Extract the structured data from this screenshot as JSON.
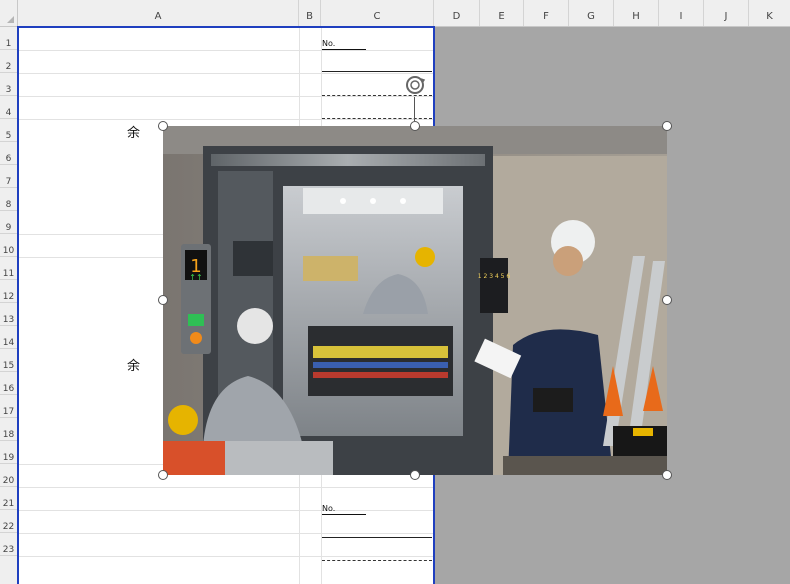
{
  "columns": [
    "A",
    "B",
    "C",
    "D",
    "E",
    "F",
    "G",
    "H",
    "I",
    "J",
    "K"
  ],
  "rows": [
    "1",
    "2",
    "3",
    "4",
    "5",
    "6",
    "7",
    "8",
    "9",
    "10",
    "11",
    "12",
    "13",
    "14",
    "15",
    "16",
    "17",
    "18",
    "19",
    "20",
    "21",
    "22",
    "23"
  ],
  "cells": {
    "a5": "余",
    "a15": "余",
    "c1": "No.",
    "c21": "No."
  },
  "image": {
    "alt": "photo-elevator-maintenance",
    "panel_digit": "1",
    "panel_arrows": "↑↑",
    "panel_buttons": "1 2 3 4 5 6"
  },
  "colors": {
    "page_break": "#1f3fbf",
    "outside_area": "#a6a6a6",
    "header_bg": "#efefef"
  }
}
